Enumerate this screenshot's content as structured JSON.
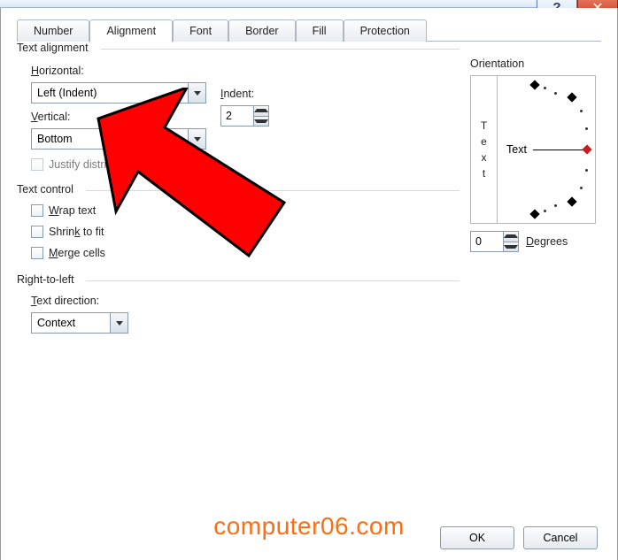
{
  "titlebar": {
    "help_glyph": "?",
    "close_glyph": "✕"
  },
  "tabs": [
    {
      "label": "Number"
    },
    {
      "label": "Alignment"
    },
    {
      "label": "Font"
    },
    {
      "label": "Border"
    },
    {
      "label": "Fill"
    },
    {
      "label": "Protection"
    }
  ],
  "groups": {
    "text_alignment": "Text alignment",
    "text_control": "Text control",
    "right_to_left": "Right-to-left"
  },
  "labels": {
    "horizontal": "Horizontal:",
    "vertical": "Vertical:",
    "indent": "Indent:",
    "justify_distributed": "Justify distributed",
    "wrap_text": "Wrap text",
    "shrink_to_fit": "Shrink to fit",
    "merge_cells": "Merge cells",
    "text_direction": "Text direction:",
    "orientation": "Orientation",
    "degrees": "Degrees",
    "text_word": "Text",
    "vt": {
      "t1": "T",
      "e": "e",
      "x": "x",
      "t2": "t"
    }
  },
  "values": {
    "horizontal": "Left (Indent)",
    "vertical": "Bottom",
    "indent": "2",
    "text_direction": "Context",
    "degrees": "0"
  },
  "buttons": {
    "ok": "OK",
    "cancel": "Cancel"
  },
  "watermark": "computer06.com"
}
